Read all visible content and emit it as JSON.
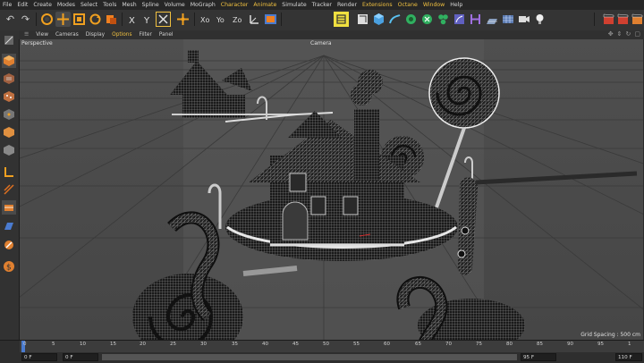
{
  "menu": [
    "File",
    "Edit",
    "Create",
    "Modes",
    "Select",
    "Tools",
    "Mesh",
    "Spline",
    "Volume",
    "MoGraph",
    "Character",
    "Animate",
    "Simulate",
    "Tracker",
    "Render",
    "Extensions",
    "Octane",
    "Window",
    "Help"
  ],
  "menu_highlight": [
    "Character",
    "Animate",
    "Extensions",
    "Octane",
    "Window"
  ],
  "viewport_menu": [
    "View",
    "Cameras",
    "Display",
    "Options",
    "Filter",
    "Panel"
  ],
  "viewport_menu_highlight": [
    "Options"
  ],
  "viewport": {
    "view_name": "Perspective",
    "camera_name": "Camera",
    "grid_spacing": "Grid Spacing : 500 cm"
  },
  "timeline": {
    "ticks": [
      "0",
      "5",
      "10",
      "15",
      "20",
      "25",
      "30",
      "35",
      "40",
      "45",
      "50",
      "55",
      "60",
      "65",
      "70",
      "75",
      "80",
      "85",
      "90",
      "95",
      "1"
    ],
    "current_frame": "0 F",
    "start_frame": "0 F",
    "end_frame": "95 F",
    "max_frame": "110 F"
  },
  "colors": {
    "accent": "#f0c040",
    "timeline_playhead": "#4a7bd0"
  }
}
